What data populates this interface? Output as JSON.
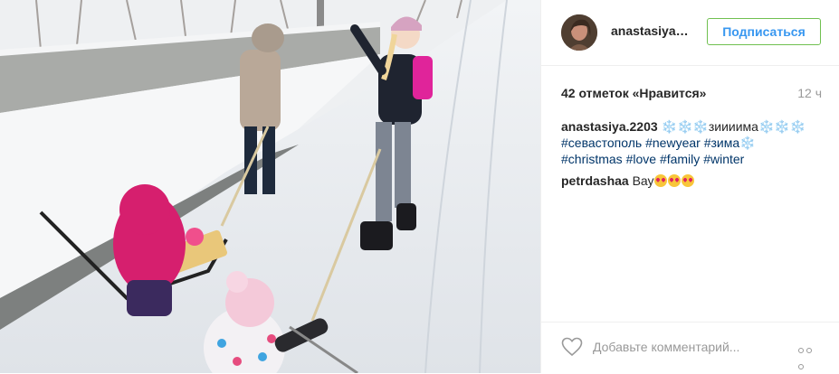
{
  "post": {
    "username": "anastasiya.2203",
    "follow_label": "Подписаться",
    "likes_text": "42 отметок «Нравится»",
    "time_ago": "12 ч",
    "caption": {
      "username": "anastasiya.2203",
      "snow_prefix": "❄️❄️❄️",
      "text": "зиииима",
      "snow_suffix": "❄️❄️❄️",
      "hashtags": [
        "#севастополь",
        "#newyear",
        "#зима",
        "#christmas",
        "#love",
        "#family",
        "#winter"
      ],
      "trailing_snow": "❄️"
    },
    "comments": [
      {
        "username": "petrdashaa",
        "text": "Вау",
        "emoji": "heart-eyes",
        "emoji_count": 3
      }
    ],
    "comment_placeholder": "Добавьте комментарий...",
    "icons": {
      "like": "heart-icon",
      "more": "ellipsis-icon"
    }
  },
  "colors": {
    "link_blue": "#3897f0",
    "hashtag": "#003569",
    "follow_border": "#70c050",
    "muted": "#999999"
  }
}
